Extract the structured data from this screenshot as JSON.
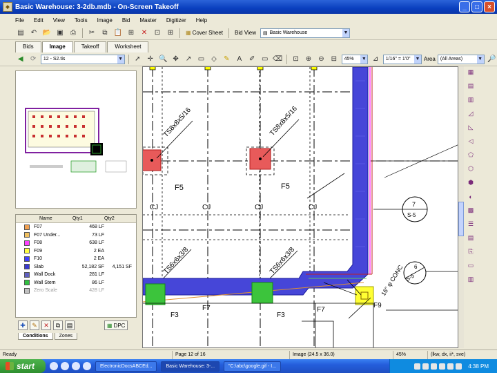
{
  "window": {
    "title": "Basic Warehouse: 3-2db.mdb - On-Screen Takeoff",
    "icon": "osc-app-icon",
    "minimize": "_",
    "maximize": "□",
    "close": "×"
  },
  "menu": [
    "File",
    "Edit",
    "View",
    "Tools",
    "Image",
    "Bid",
    "Master",
    "Digitizer",
    "Help"
  ],
  "toolbar1": {
    "cover_sheet": "Cover Sheet",
    "bid_view": "Bid View",
    "bid_select": "Basic Warehouse"
  },
  "tabs": [
    "Bids",
    "Image",
    "Takeoff",
    "Worksheet"
  ],
  "toolbar2": {
    "page_select": "12 - S2.tis",
    "zoom": "45%",
    "scale": "1/16\" = 1'0\"",
    "area_label": "Area",
    "area_select": "(All Areas)"
  },
  "conditions": {
    "headers": {
      "name": "Name",
      "qty1": "Qty1",
      "qty2": "Qty2"
    },
    "rows": [
      {
        "name": "F07",
        "qty1": "468 LF",
        "qty2": "",
        "color": "#f0a050"
      },
      {
        "name": "F07 Under...",
        "qty1": "73 LF",
        "qty2": "",
        "color": "#f0c060"
      },
      {
        "name": "F08",
        "qty1": "638 LF",
        "qty2": "",
        "color": "#ff40ff"
      },
      {
        "name": "F09",
        "qty1": "2 EA",
        "qty2": "",
        "color": "#ffff40"
      },
      {
        "name": "F10",
        "qty1": "2 EA",
        "qty2": "",
        "color": "#4040ff"
      },
      {
        "name": "Slab",
        "qty1": "52,182 SF",
        "qty2": "4,151 SF",
        "color": "#3a3ad0"
      },
      {
        "name": "Wall Dock",
        "qty1": "281 LF",
        "qty2": "",
        "color": "#6060c0"
      },
      {
        "name": "Wall Stem",
        "qty1": "86 LF",
        "qty2": "",
        "color": "#30c040"
      },
      {
        "name": "Zero Scale",
        "qty1": "428 LF",
        "qty2": "",
        "color": "#c0c0c0"
      }
    ],
    "dpc_label": "DPC",
    "tab_conditions": "Conditions",
    "tab_zones": "Zones"
  },
  "drawing": {
    "labels": {
      "f5a": "F5",
      "f5b": "F5",
      "f3a": "F3",
      "f3b": "F3",
      "f7a": "F7",
      "f7b": "F7",
      "f9": "F9",
      "cj1": "CJ",
      "cj2": "CJ",
      "cj3": "CJ",
      "cj4": "CJ",
      "ts1": "TS8x8x5/16",
      "ts2": "TS8x8x5/16",
      "ts3": "TS6x6x3/8",
      "ts4": "TS6x6x3/8",
      "sec7_top": "7",
      "sec7_bot": "S-5",
      "sec6_top": "6",
      "sec6_bot": "S-5",
      "conc": "16\" φ CONC"
    }
  },
  "status": {
    "ready": "Ready",
    "page": "Page 12 of 16",
    "image": "Image (24.5 x 36.0)",
    "zoom": "45%",
    "units": "(lkw, dx, ii*, sve)"
  },
  "taskbar": {
    "start": "start",
    "tasks": [
      "ElectronicDocsABCEd...",
      "Basic Warehouse: 3-...",
      "\"C:\\abc\\google.gif - I..."
    ],
    "clock": "4:38 PM"
  }
}
